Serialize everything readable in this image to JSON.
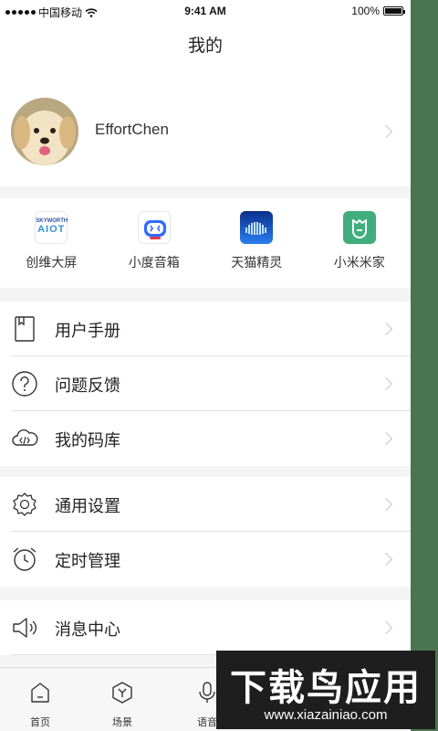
{
  "status_bar": {
    "carrier": "中国移动",
    "time": "9:41 AM",
    "battery": "100%"
  },
  "header": {
    "title": "我的"
  },
  "profile": {
    "username": "EffortChen"
  },
  "devices": [
    {
      "label": "创维大屏",
      "icon": "skyworth-logo"
    },
    {
      "label": "小度音箱",
      "icon": "xiaodu-logo"
    },
    {
      "label": "天猫精灵",
      "icon": "tmall-genie-logo"
    },
    {
      "label": "小米米家",
      "icon": "mijia-logo"
    }
  ],
  "device_logo_text": {
    "skyworth_top": "SKYWORTH",
    "skyworth_main": "AIOT"
  },
  "menu_group_1": [
    {
      "label": "用户手册",
      "icon": "book-icon"
    },
    {
      "label": "问题反馈",
      "icon": "question-icon"
    },
    {
      "label": "我的码库",
      "icon": "cloud-code-icon"
    }
  ],
  "menu_group_2": [
    {
      "label": "通用设置",
      "icon": "gear-icon"
    },
    {
      "label": "定时管理",
      "icon": "alarm-clock-icon"
    }
  ],
  "menu_group_3": [
    {
      "label": "消息中心",
      "icon": "speaker-icon"
    }
  ],
  "tabbar": [
    {
      "label": "首页",
      "icon": "home-icon"
    },
    {
      "label": "场景",
      "icon": "scene-icon"
    },
    {
      "label": "语音",
      "icon": "mic-icon"
    }
  ],
  "watermark": {
    "title": "下载鸟应用",
    "url": "www.xiazainiao.com"
  },
  "colors": {
    "background": "#f4f4f4",
    "side_strip": "#4a7550",
    "mijia_green": "#3fae7c",
    "xiaodu_blue": "#2f6bff",
    "tmall_blue": "#1450c8"
  }
}
